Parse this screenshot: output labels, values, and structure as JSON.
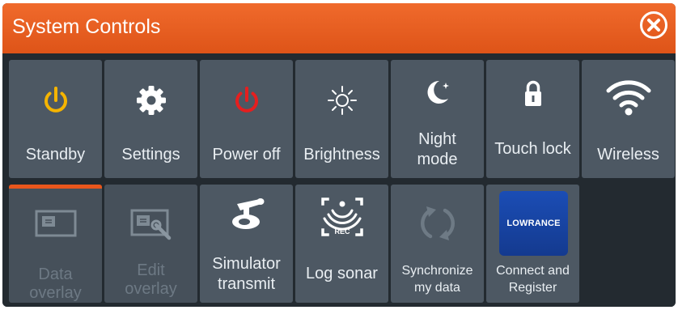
{
  "dialog": {
    "title": "System Controls",
    "close_icon": "close-circle-icon"
  },
  "colors": {
    "title_bar": "#e85a1e",
    "tile": "#4d5863",
    "background": "#232a30",
    "standby_icon": "#f5b400",
    "power_off_icon": "#e51f1f",
    "logo": "#1b4db5"
  },
  "tiles": [
    {
      "label": "Standby",
      "icon": "power-icon",
      "enabled": true
    },
    {
      "label": "Settings",
      "icon": "gear-icon",
      "enabled": true
    },
    {
      "label": "Power off",
      "icon": "power-icon",
      "enabled": true
    },
    {
      "label": "Brightness",
      "icon": "sun-icon",
      "enabled": true
    },
    {
      "label_line1": "Night",
      "label_line2": "mode",
      "icon": "moon-icon",
      "enabled": true
    },
    {
      "label": "Touch lock",
      "icon": "lock-icon",
      "enabled": true
    },
    {
      "label": "Wireless",
      "icon": "wifi-icon",
      "enabled": true
    },
    {
      "label_line1": "Data",
      "label_line2": "overlay",
      "icon": "data-overlay-icon",
      "enabled": false,
      "selected": true
    },
    {
      "label_line1": "Edit",
      "label_line2": "overlay",
      "icon": "edit-overlay-icon",
      "enabled": false
    },
    {
      "label_line1": "Simulator",
      "label_line2": "transmit",
      "icon": "transducer-icon",
      "enabled": true
    },
    {
      "label": "Log sonar",
      "icon": "sonar-record-icon",
      "enabled": true,
      "icon_text": "REC"
    },
    {
      "label_line1": "Synchronize",
      "label_line2": "my data",
      "icon": "sync-icon",
      "enabled": true
    },
    {
      "label_line1": "Connect and",
      "label_line2": "Register",
      "icon": "lowrance-logo",
      "enabled": true,
      "logo_text": "LOWRANCE"
    }
  ]
}
